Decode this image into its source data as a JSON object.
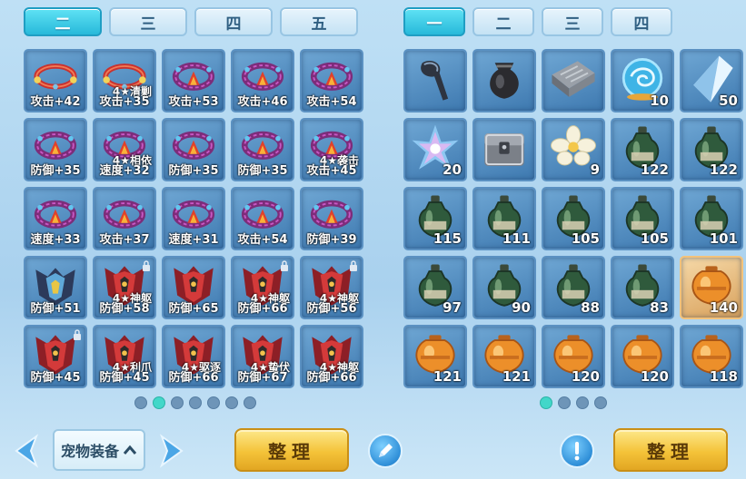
{
  "left": {
    "tabs": [
      {
        "label": "二",
        "active": true
      },
      {
        "label": "三",
        "active": false
      },
      {
        "label": "四",
        "active": false
      },
      {
        "label": "五",
        "active": false
      }
    ],
    "items": [
      {
        "icon": "red-bracelet-icon",
        "stat": "攻击+42",
        "tag": "",
        "lock": false
      },
      {
        "icon": "red-bracelet-icon",
        "stat": "攻击+35",
        "tag": "4★清剿",
        "lock": false
      },
      {
        "icon": "thorn-ring-icon",
        "stat": "攻击+53",
        "tag": "",
        "lock": false
      },
      {
        "icon": "thorn-ring-icon",
        "stat": "攻击+46",
        "tag": "",
        "lock": false
      },
      {
        "icon": "thorn-ring-icon",
        "stat": "攻击+54",
        "tag": "",
        "lock": false
      },
      {
        "icon": "thorn-ring-icon",
        "stat": "防御+35",
        "tag": "",
        "lock": false
      },
      {
        "icon": "thorn-ring-icon",
        "stat": "速度+32",
        "tag": "4★相依",
        "lock": false
      },
      {
        "icon": "thorn-ring-icon",
        "stat": "防御+35",
        "tag": "",
        "lock": false
      },
      {
        "icon": "thorn-ring-icon",
        "stat": "防御+35",
        "tag": "",
        "lock": false
      },
      {
        "icon": "thorn-ring-icon",
        "stat": "攻击+45",
        "tag": "4★袭击",
        "lock": false
      },
      {
        "icon": "thorn-ring-icon",
        "stat": "速度+33",
        "tag": "",
        "lock": false
      },
      {
        "icon": "thorn-ring-icon",
        "stat": "攻击+37",
        "tag": "",
        "lock": false
      },
      {
        "icon": "thorn-ring-icon",
        "stat": "速度+31",
        "tag": "",
        "lock": false
      },
      {
        "icon": "thorn-ring-icon",
        "stat": "攻击+54",
        "tag": "",
        "lock": false
      },
      {
        "icon": "thorn-ring-icon",
        "stat": "防御+39",
        "tag": "",
        "lock": false
      },
      {
        "icon": "dark-armor-icon",
        "stat": "防御+51",
        "tag": "",
        "lock": false
      },
      {
        "icon": "red-armor-icon",
        "stat": "防御+58",
        "tag": "4★神躯",
        "lock": true
      },
      {
        "icon": "red-armor-icon",
        "stat": "防御+65",
        "tag": "",
        "lock": false
      },
      {
        "icon": "red-armor-icon",
        "stat": "防御+66",
        "tag": "4★神躯",
        "lock": true
      },
      {
        "icon": "red-armor-icon",
        "stat": "防御+56",
        "tag": "4★神躯",
        "lock": true
      },
      {
        "icon": "red-armor-icon",
        "stat": "防御+45",
        "tag": "",
        "lock": true
      },
      {
        "icon": "red-armor-icon",
        "stat": "防御+45",
        "tag": "4★利爪",
        "lock": false
      },
      {
        "icon": "red-armor-icon",
        "stat": "防御+66",
        "tag": "4★驱逐",
        "lock": false
      },
      {
        "icon": "red-armor-icon",
        "stat": "防御+67",
        "tag": "4★蛰伏",
        "lock": false
      },
      {
        "icon": "red-armor-icon",
        "stat": "防御+66",
        "tag": "4★神躯",
        "lock": false
      }
    ],
    "pager": {
      "count": 7,
      "active": 1
    },
    "equip_select_label": "宠物装备",
    "sort_label": "整理"
  },
  "right": {
    "tabs": [
      {
        "label": "一",
        "active": true
      },
      {
        "label": "二",
        "active": false
      },
      {
        "label": "三",
        "active": false
      },
      {
        "label": "四",
        "active": false
      }
    ],
    "items": [
      {
        "icon": "slingshot-icon",
        "count": ""
      },
      {
        "icon": "black-pouch-icon",
        "count": ""
      },
      {
        "icon": "iron-ingot-icon",
        "count": ""
      },
      {
        "icon": "swirl-orb-icon",
        "count": "10"
      },
      {
        "icon": "crystal-icon",
        "count": "50"
      },
      {
        "icon": "star-crystal-icon",
        "count": "20"
      },
      {
        "icon": "locked-chest-icon",
        "count": ""
      },
      {
        "icon": "white-flower-icon",
        "count": "9"
      },
      {
        "icon": "green-jar-icon",
        "count": "122"
      },
      {
        "icon": "green-jar-icon",
        "count": "122"
      },
      {
        "icon": "green-jar-icon",
        "count": "115"
      },
      {
        "icon": "green-jar-icon",
        "count": "111"
      },
      {
        "icon": "green-jar-icon",
        "count": "105"
      },
      {
        "icon": "green-jar-icon",
        "count": "105"
      },
      {
        "icon": "green-jar-icon",
        "count": "101"
      },
      {
        "icon": "green-jar-icon",
        "count": "97"
      },
      {
        "icon": "green-jar-icon",
        "count": "90"
      },
      {
        "icon": "green-jar-icon",
        "count": "88"
      },
      {
        "icon": "green-jar-icon",
        "count": "83"
      },
      {
        "icon": "orange-jar-icon",
        "count": "140",
        "highlight": true
      },
      {
        "icon": "orange-jar-icon",
        "count": "121"
      },
      {
        "icon": "orange-jar-icon",
        "count": "121"
      },
      {
        "icon": "orange-jar-icon",
        "count": "120"
      },
      {
        "icon": "orange-jar-icon",
        "count": "120"
      },
      {
        "icon": "orange-jar-icon",
        "count": "118"
      }
    ],
    "pager": {
      "count": 4,
      "active": 0
    },
    "sort_label": "整理"
  },
  "colors": {
    "slot_bg": "#4d86bb",
    "tab_active": "#27b9da",
    "sort_button": "#f4c339",
    "dot_active": "#42d7c9"
  }
}
